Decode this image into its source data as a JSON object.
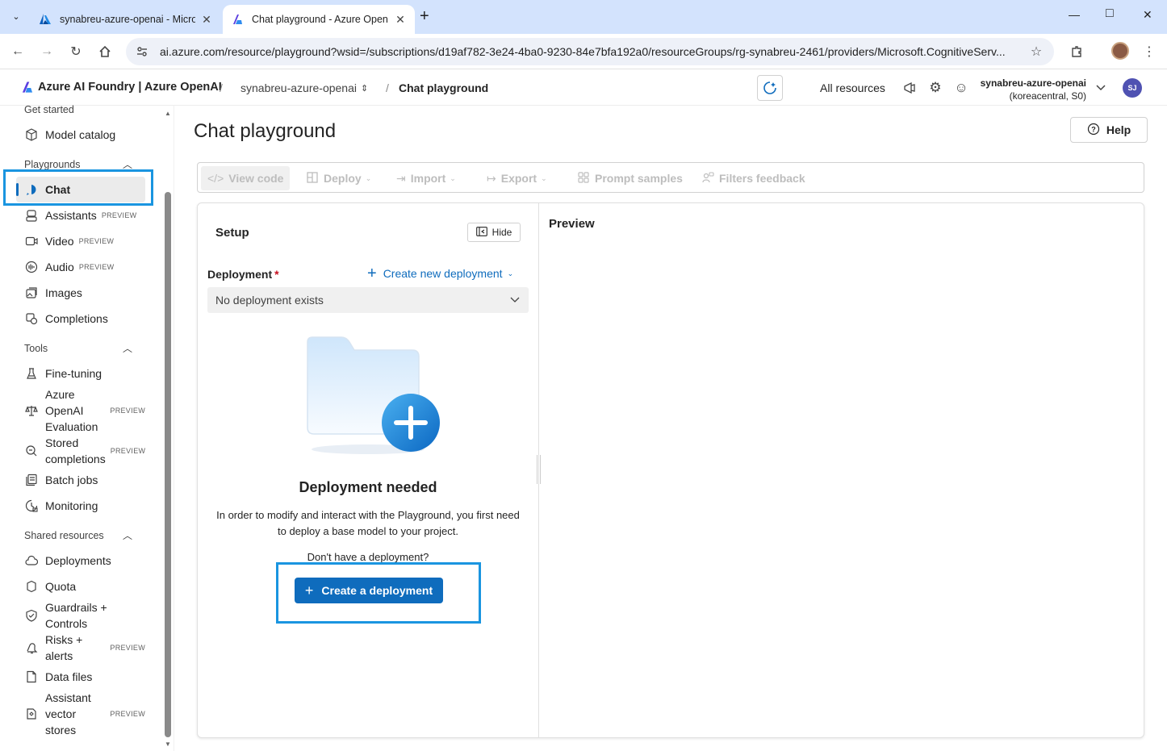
{
  "browser": {
    "tabs": [
      {
        "title": "synabreu-azure-openai - Micro"
      },
      {
        "title": "Chat playground - Azure Open"
      }
    ],
    "url": "ai.azure.com/resource/playground?wsid=/subscriptions/d19af782-3e24-4ba0-9230-84e7bfa192a0/resourceGroups/rg-synabreu-2461/providers/Microsoft.CognitiveServ..."
  },
  "header": {
    "brand": "Azure AI Foundry | Azure OpenAI",
    "resource": "synabreu-azure-openai",
    "page": "Chat playground",
    "all_resources": "All resources",
    "account_name": "synabreu-azure-openai",
    "account_region": "(koreacentral, S0)",
    "avatar_initials": "SJ"
  },
  "sidebar": {
    "get_started": "Get started",
    "model_catalog": "Model catalog",
    "playgrounds": "Playgrounds",
    "chat": "Chat",
    "assistants": "Assistants",
    "video": "Video",
    "audio": "Audio",
    "images": "Images",
    "completions": "Completions",
    "tools": "Tools",
    "fine_tuning": "Fine-tuning",
    "aoai_eval_1": "Azure",
    "aoai_eval_2": "OpenAI",
    "aoai_eval_3": "Evaluation",
    "stored_1": "Stored",
    "stored_2": "completions",
    "batch_jobs": "Batch jobs",
    "monitoring": "Monitoring",
    "shared_resources": "Shared resources",
    "deployments": "Deployments",
    "quota": "Quota",
    "guardrails_1": "Guardrails +",
    "guardrails_2": "Controls",
    "risks_1": "Risks +",
    "risks_2": "alerts",
    "data_files": "Data files",
    "vector_1": "Assistant",
    "vector_2": "vector",
    "vector_3": "stores",
    "preview_badge": "PREVIEW"
  },
  "main": {
    "title": "Chat playground",
    "help": "Help",
    "toolbar": {
      "view_code": "View code",
      "deploy": "Deploy",
      "import": "Import",
      "export": "Export",
      "prompt_samples": "Prompt samples",
      "filters_feedback": "Filters feedback"
    },
    "setup": {
      "title": "Setup",
      "hide": "Hide",
      "deployment_label": "Deployment",
      "required_mark": "*",
      "create_new": "Create new deployment",
      "select_value": "No deployment exists",
      "needed_title": "Deployment needed",
      "needed_desc": "In order to modify and interact with the Playground, you first need to deploy a base model to your project.",
      "no_deployment": "Don't have a deployment?",
      "cta": "Create a deployment"
    },
    "preview_title": "Preview"
  }
}
